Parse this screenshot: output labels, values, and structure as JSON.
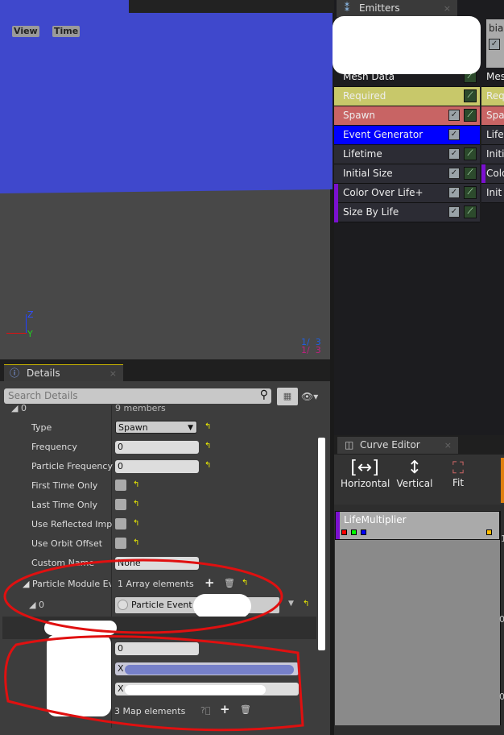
{
  "viewport": {
    "view_label": "View",
    "time_label": "Time",
    "axis_z": "Z",
    "axis_y": "Y",
    "counter_top": "1/  3",
    "counter_bottom": "1/  3"
  },
  "emitters": {
    "tab_label": "Emitters",
    "close": "×",
    "col1": [
      {
        "label": "Mesh Data",
        "bg": "#1c1c1f",
        "check": false,
        "graph": true,
        "bar": false
      },
      {
        "label": "Required",
        "bg": "#c8c86a",
        "check": false,
        "graph": true,
        "bar": false
      },
      {
        "label": "Spawn",
        "bg": "#c86464",
        "check": true,
        "graph": true,
        "bar": false
      },
      {
        "label": "Event Generator",
        "bg": "#0000ff",
        "check": true,
        "graph": false,
        "bar": false
      },
      {
        "label": "Lifetime",
        "bg": "#2c2c34",
        "check": true,
        "graph": true,
        "bar": false
      },
      {
        "label": "Initial Size",
        "bg": "#2c2c34",
        "check": true,
        "graph": true,
        "bar": false
      },
      {
        "label": "Color Over Life+",
        "bg": "#2c2c34",
        "check": true,
        "graph": true,
        "bar": true
      },
      {
        "label": "Size By Life",
        "bg": "#2c2c34",
        "check": true,
        "graph": true,
        "bar": true
      }
    ],
    "col2_header": "bian",
    "col2": [
      {
        "label": "Mesh",
        "bg": "#1c1c1f"
      },
      {
        "label": "Req",
        "bg": "#c8c86a"
      },
      {
        "label": "Spa",
        "bg": "#c86464"
      },
      {
        "label": "Life",
        "bg": "#2c2c34"
      },
      {
        "label": "Initi",
        "bg": "#2c2c34"
      },
      {
        "label": "Colo",
        "bg": "#2c2c34"
      },
      {
        "label": "Init",
        "bg": "#2c2c34"
      }
    ]
  },
  "details": {
    "tab_label": "Details",
    "close": "×",
    "search_placeholder": "Search Details",
    "struct_index": "0",
    "struct_value": "9 members",
    "type_label": "Type",
    "type_value": "Spawn",
    "frequency_label": "Frequency",
    "frequency_value": "0",
    "particle_frequency_label": "Particle Frequency",
    "particle_frequency_value": "0",
    "first_time_only": "First Time Only",
    "last_time_only": "Last Time Only",
    "use_reflected": "Use Reflected Impa",
    "use_orbit": "Use Orbit Offset",
    "custom_name_label": "Custom Name",
    "custom_name_value": "None",
    "pme_label": "Particle Module Eve",
    "pme_value": "1 Array elements",
    "pme_index": "0",
    "pme_item": "Particle Event",
    "lower_field_value": "0",
    "vec_x1": "X",
    "vec_x2": "X",
    "map_value": "3 Map elements"
  },
  "curve": {
    "tab_label": "Curve Editor",
    "close": "×",
    "horizontal": "Horizontal",
    "vertical": "Vertical",
    "fit": "Fit",
    "track": "LifeMultiplier",
    "tick_1": "1",
    "tick_0a": "0",
    "tick_0b": "0"
  }
}
